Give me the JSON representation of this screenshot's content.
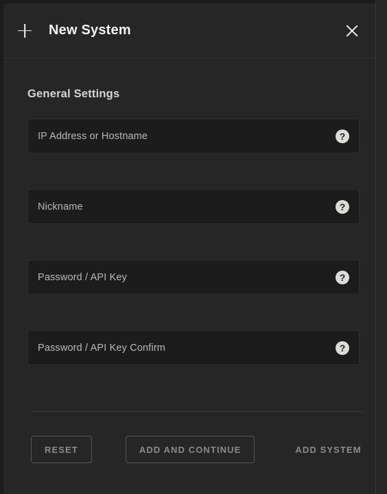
{
  "header": {
    "title": "New System",
    "add_icon": "plus-icon",
    "close_icon": "close-icon"
  },
  "section": {
    "title": "General Settings"
  },
  "fields": [
    {
      "name": "ip-address-or-hostname",
      "placeholder": "IP Address or Hostname",
      "value": "",
      "type": "text",
      "help_icon": "?"
    },
    {
      "name": "nickname",
      "placeholder": "Nickname",
      "value": "",
      "type": "text",
      "help_icon": "?"
    },
    {
      "name": "password-api-key",
      "placeholder": "Password / API Key",
      "value": "",
      "type": "text",
      "help_icon": "?"
    },
    {
      "name": "password-api-key-confirm",
      "placeholder": "Password / API Key Confirm",
      "value": "",
      "type": "text",
      "help_icon": "?"
    }
  ],
  "actions": {
    "reset_label": "RESET",
    "add_and_continue_label": "ADD AND CONTINUE",
    "add_system_label": "ADD SYSTEM"
  },
  "colors": {
    "page_background": "#1b1b1b",
    "panel_background": "#262626",
    "input_background": "#1c1c1c",
    "input_border": "#2e2e2e",
    "divider": "#3a3a3a",
    "title_text": "#f2f2f2",
    "heading_text": "#d6d6d6",
    "placeholder_text": "#b9b9b9",
    "button_text": "#8b8b8b",
    "button_border": "#575757",
    "help_icon_background": "#dcdcd8",
    "help_icon_text": "#1e1e1e"
  }
}
